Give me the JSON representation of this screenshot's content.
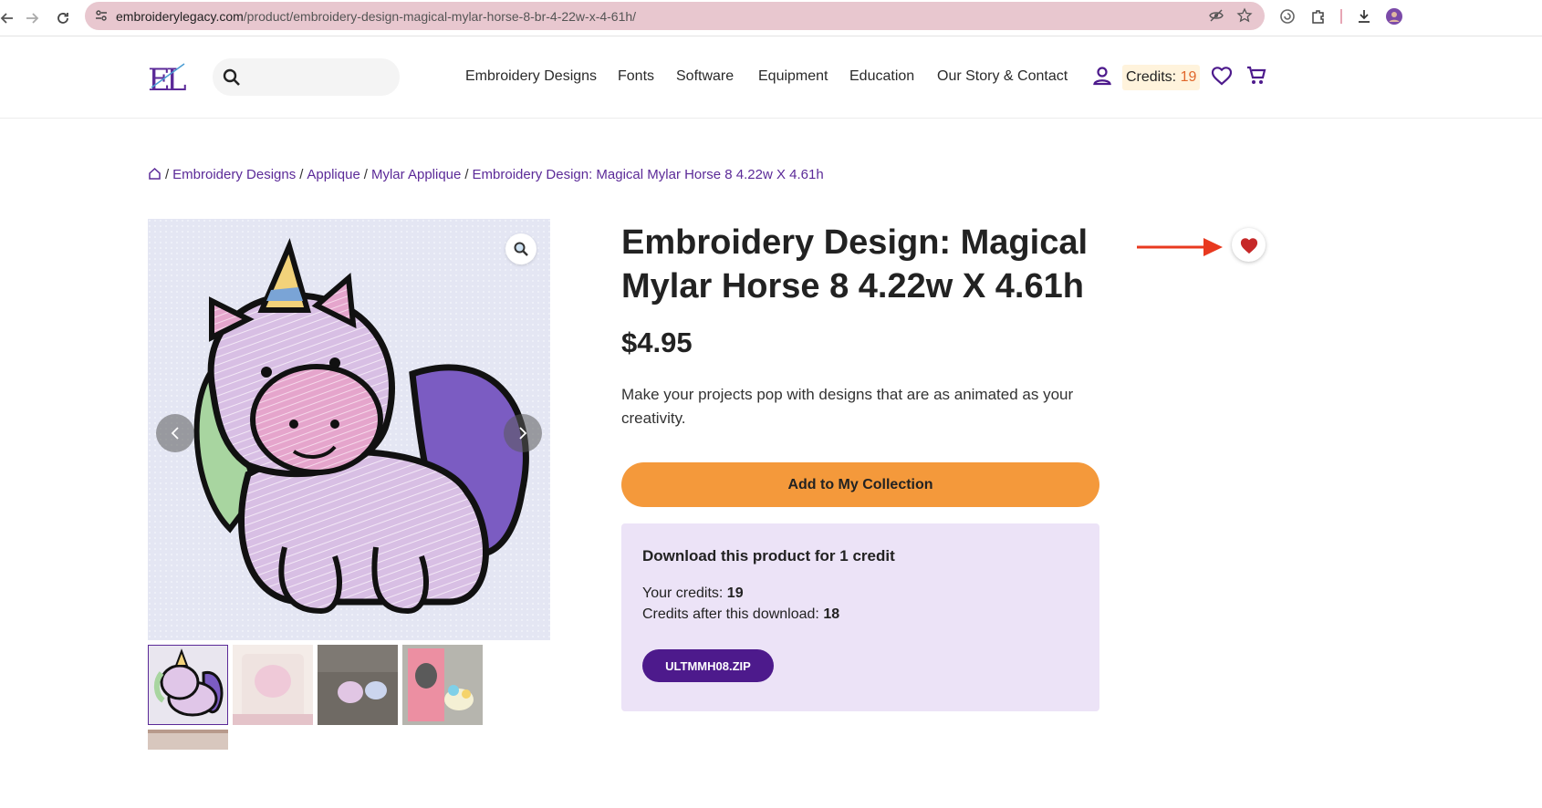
{
  "browser": {
    "url_domain": "embroiderylegacy.com",
    "url_path": "/product/embroidery-design-magical-mylar-horse-8-br-4-22w-x-4-61h/"
  },
  "header": {
    "menu": [
      "Embroidery Designs",
      "Fonts",
      "Software",
      "Equipment",
      "Education",
      "Our Story & Contact"
    ],
    "credits_label": "Credits: ",
    "credits_value": "19"
  },
  "breadcrumb": {
    "items": [
      "Embroidery Designs",
      "Applique",
      "Mylar Applique",
      "Embroidery Design: Magical Mylar Horse 8 4.22w X 4.61h"
    ]
  },
  "product": {
    "title": "Embroidery Design: Magical Mylar Horse 8 4.22w X 4.61h",
    "price": "$4.95",
    "description": "Make your projects pop with designs that are as animated as your creativity.",
    "add_button": "Add to My Collection"
  },
  "download": {
    "heading": "Download this product for 1 credit",
    "your_credits_label": "Your credits: ",
    "your_credits_value": "19",
    "after_label": "Credits after this download: ",
    "after_value": "18",
    "zip_button": "ULTMMH08.ZIP"
  },
  "colors": {
    "brand_purple": "#5b2a98",
    "accent_orange": "#f4993b",
    "heart_red": "#c62828",
    "annotation_arrow": "#e8391f"
  }
}
